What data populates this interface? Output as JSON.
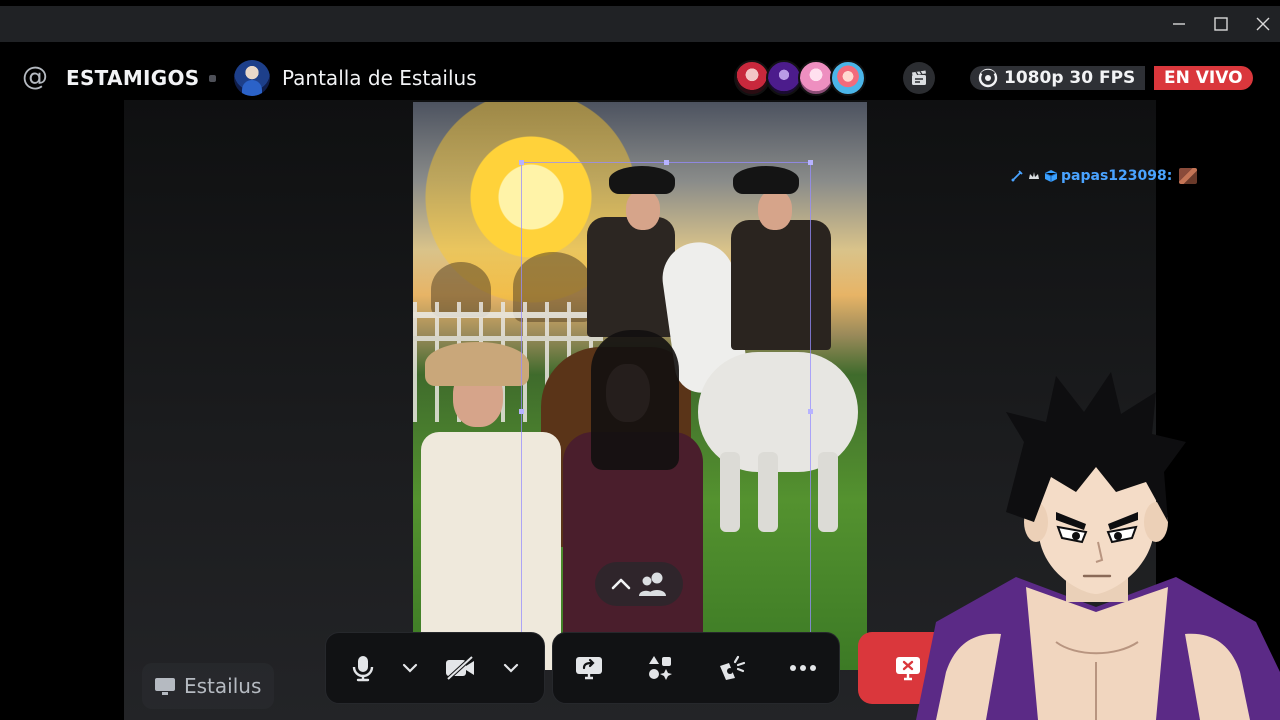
{
  "window": {
    "minimize_icon": "minimize-icon",
    "maximize_icon": "maximize-icon",
    "close_icon": "close-icon"
  },
  "header": {
    "at_symbol": "@",
    "server_name": "ESTAMIGOS",
    "stream_title": "Pantalla de Estailus",
    "quality": "1080p 30 FPS",
    "live_label": "EN VIVO"
  },
  "chat": {
    "username": "papas123098:"
  },
  "stage": {
    "streamer_name": "Estailus"
  },
  "controls": {
    "mic_icon": "microphone-icon",
    "camera_icon": "camera-off-icon",
    "share_icon": "screen-share-icon",
    "activities_icon": "activities-icon",
    "soundboard_icon": "soundboard-icon",
    "more_icon": "more-icon",
    "leave_icon": "stop-stream-icon"
  },
  "colors": {
    "live_red": "#da373c",
    "chat_username": "#4aa3ff",
    "panel": "#111214",
    "badge_bg": "#2e3035"
  }
}
